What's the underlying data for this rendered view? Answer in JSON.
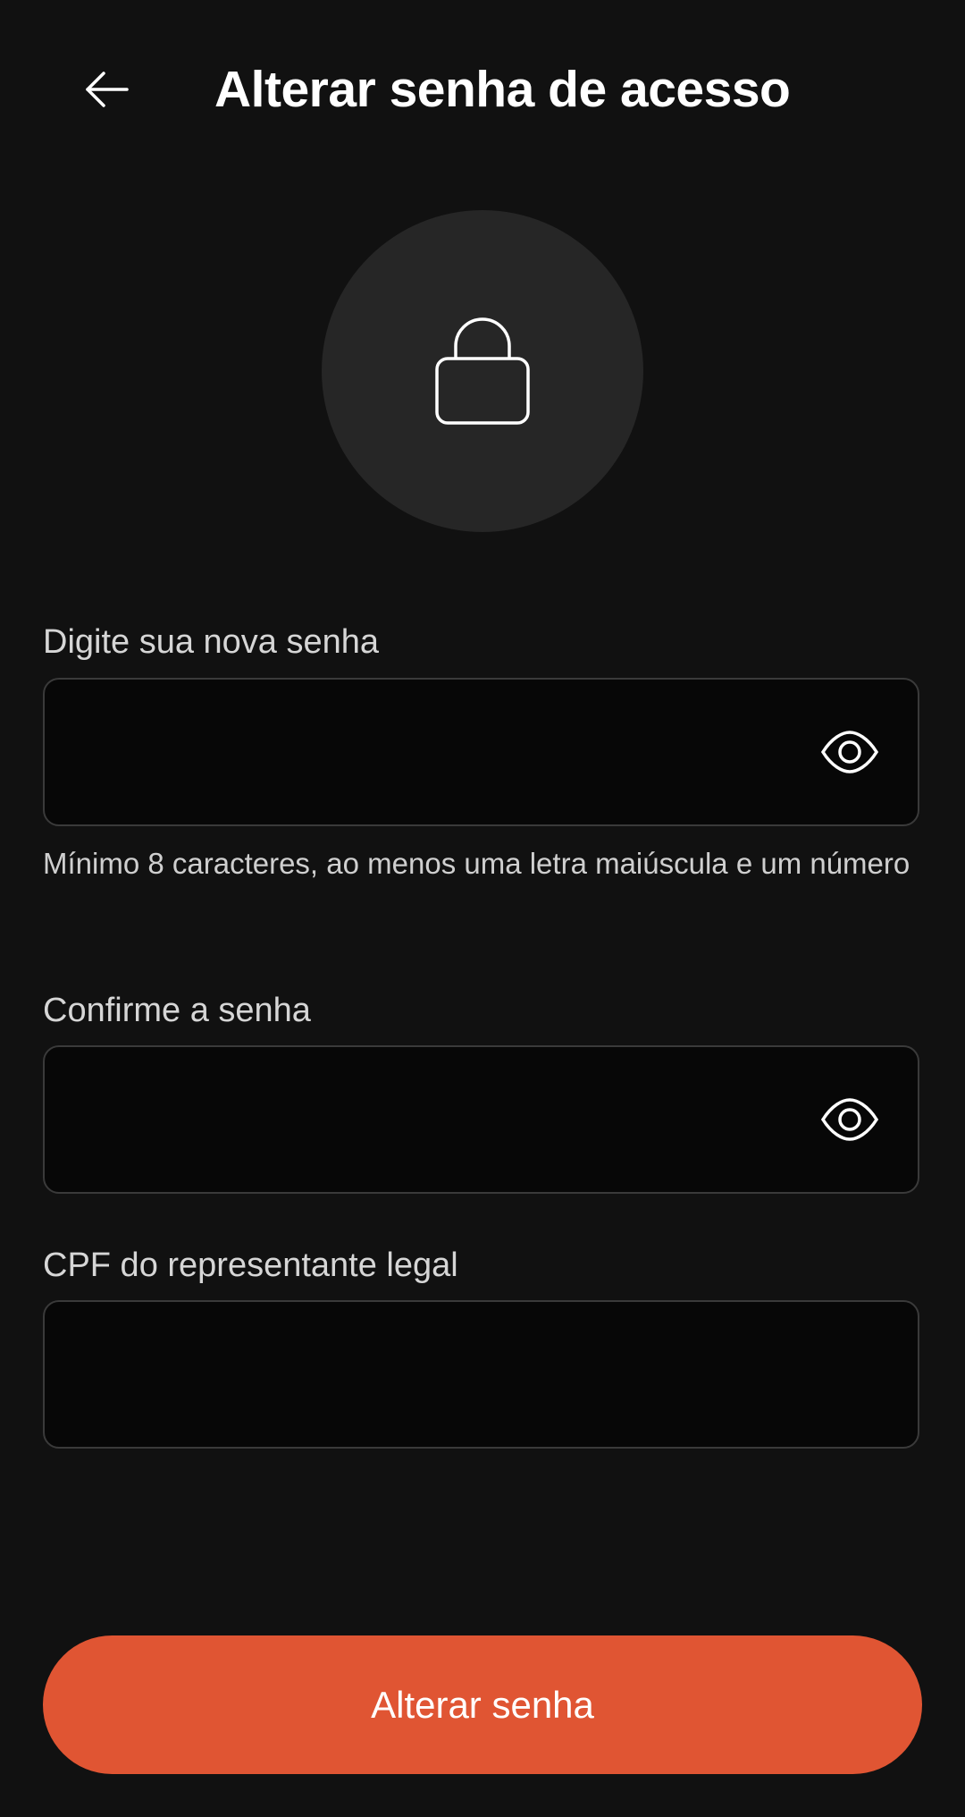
{
  "header": {
    "back_icon": "arrow-left-icon",
    "title": "Alterar senha de acesso"
  },
  "hero": {
    "icon": "lock-icon"
  },
  "form": {
    "new_password": {
      "label": "Digite sua nova senha",
      "value": "",
      "toggle_icon": "eye-icon"
    },
    "helper": "Mínimo 8 caracteres, ao menos uma letra maiúscula e um número",
    "confirm_password": {
      "label": "Confirme a senha",
      "value": "",
      "toggle_icon": "eye-icon"
    },
    "cpf": {
      "label": "CPF do representante legal",
      "value": ""
    }
  },
  "submit": {
    "label": "Alterar senha"
  },
  "colors": {
    "background": "#111111",
    "accent": "#e05533",
    "field_background": "#070707",
    "field_border": "#3a3a3a",
    "icon_circle": "#262626"
  }
}
